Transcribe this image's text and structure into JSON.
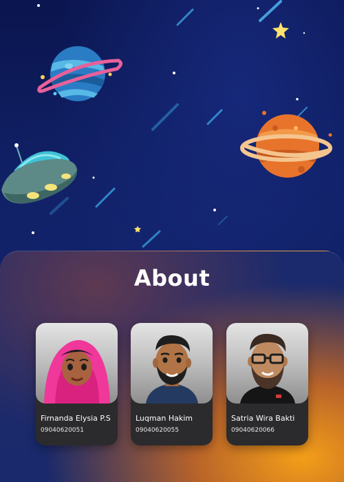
{
  "about": {
    "title": "About"
  },
  "members": [
    {
      "name": "Firnanda Elysia P.S",
      "nim": "09040620051"
    },
    {
      "name": "Luqman Hakim",
      "nim": "09040620055"
    },
    {
      "name": "Satria Wira Bakti",
      "nim": "09040620066"
    }
  ],
  "colors": {
    "background": "#0d1a57",
    "panel": "#1c2c6c",
    "card": "#2b2b2d",
    "text": "#ffffff",
    "accent_orange": "#f08a24"
  }
}
